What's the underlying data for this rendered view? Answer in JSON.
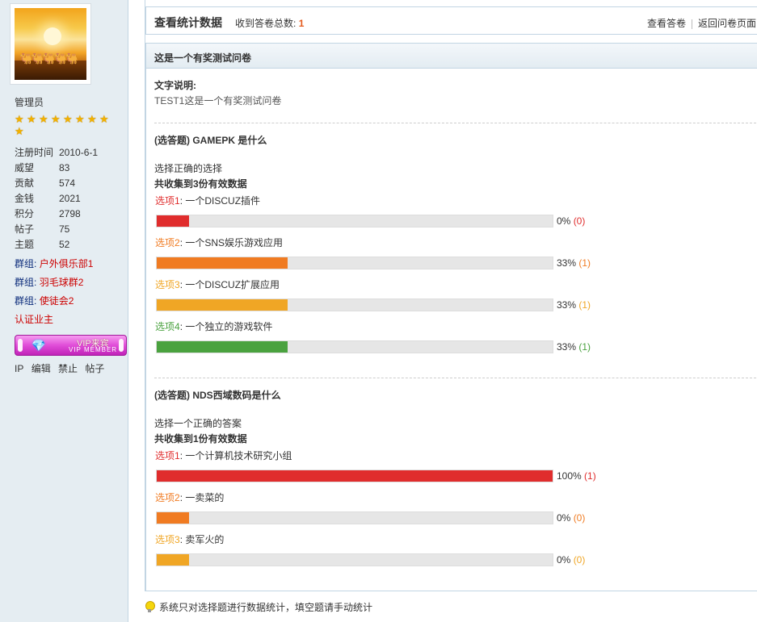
{
  "sidebar": {
    "user_role": "管理员",
    "star_count": 9,
    "stats": [
      {
        "label": "注册时间",
        "value": "2010-6-1"
      },
      {
        "label": "威望",
        "value": "83"
      },
      {
        "label": "贡献",
        "value": "574"
      },
      {
        "label": "金钱",
        "value": "2021"
      },
      {
        "label": "积分",
        "value": "2798"
      },
      {
        "label": "帖子",
        "value": "75"
      },
      {
        "label": "主题",
        "value": "52"
      }
    ],
    "groups": [
      {
        "label": "群组",
        "value": "户外俱乐部1"
      },
      {
        "label": "群组",
        "value": "羽毛球群2"
      },
      {
        "label": "群组",
        "value": "使徒会2"
      }
    ],
    "certification": "认证业主",
    "vip_badge": {
      "title": "VIP来宾",
      "subtitle": "VIP MEMBER"
    },
    "admin_links": [
      "IP",
      "编辑",
      "禁止",
      "帖子"
    ]
  },
  "header": {
    "title": "查看统计数据",
    "count_label": "收到答卷总数:",
    "count_value": "1",
    "links": [
      "查看答卷",
      "返回问卷页面"
    ]
  },
  "survey": {
    "name": "这是一个有奖测试问卷",
    "desc_label": "文字说明:",
    "desc_text": "TEST1这是一个有奖测试问卷"
  },
  "questions": [
    {
      "title": "(选答题) GAMEPK 是什么",
      "instruction": "选择正确的选择",
      "collected": "共收集到3份有效数据",
      "options": [
        {
          "label": "选项1",
          "text": "一个DISCUZ插件",
          "percent": 0,
          "pct_text": "0%",
          "count": "(0)",
          "color": "#e02d2d"
        },
        {
          "label": "选项2",
          "text": "一个SNS娱乐游戏应用",
          "percent": 33,
          "pct_text": "33%",
          "count": "(1)",
          "color": "#f07b22"
        },
        {
          "label": "选项3",
          "text": "一个DISCUZ扩展应用",
          "percent": 33,
          "pct_text": "33%",
          "count": "(1)",
          "color": "#f0a625"
        },
        {
          "label": "选项4",
          "text": "一个独立的游戏软件",
          "percent": 33,
          "pct_text": "33%",
          "count": "(1)",
          "color": "#4aa23f"
        }
      ]
    },
    {
      "title": "(选答题) NDS西域数码是什么",
      "instruction": "选择一个正确的答案",
      "collected": "共收集到1份有效数据",
      "options": [
        {
          "label": "选项1",
          "text": "一个计算机技术研究小组",
          "percent": 100,
          "pct_text": "100%",
          "count": "(1)",
          "color": "#e02d2d"
        },
        {
          "label": "选项2",
          "text": "一卖菜的",
          "percent": 0,
          "pct_text": "0%",
          "count": "(0)",
          "color": "#f07b22"
        },
        {
          "label": "选项3",
          "text": "卖军火的",
          "percent": 0,
          "pct_text": "0%",
          "count": "(0)",
          "color": "#f0a625"
        }
      ]
    }
  ],
  "footer_tip": "系统只对选择题进行数据统计，填空题请手动统计"
}
